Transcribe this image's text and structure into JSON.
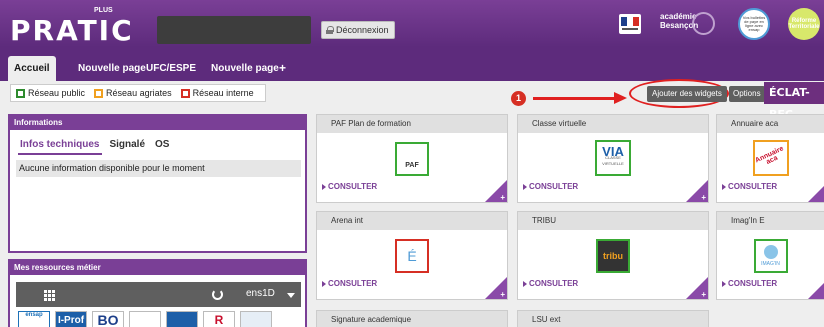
{
  "header": {
    "logo_main": "PRATIC",
    "logo_plus": "PLUS",
    "logout_label": "Déconnexion",
    "academie": [
      "académie",
      "Besançon"
    ],
    "badge_bulletins": "Vos bulletins de paye en ligne avec ensap",
    "badge_reforme": [
      "Réforme",
      "Territoriale"
    ]
  },
  "tabs": [
    {
      "label": "Accueil"
    },
    {
      "label": "Nouvelle page"
    },
    {
      "label": "UFC/ESPE"
    },
    {
      "label": "Nouvelle page"
    },
    {
      "label": "+"
    }
  ],
  "filters": [
    {
      "label": "Réseau public",
      "color": "#2e8b2e"
    },
    {
      "label": "Réseau agriates",
      "color": "#f0a020"
    },
    {
      "label": "Réseau interne",
      "color": "#d62f24"
    }
  ],
  "actions": {
    "add_widgets": "Ajouter des widgets",
    "options": "Options",
    "eclat": "ÉCLAT-BFC"
  },
  "annotation": {
    "number": "1"
  },
  "informations": {
    "title": "Informations",
    "tabs": [
      "Infos techniques",
      "Signalé",
      "OS"
    ],
    "message": "Aucune information disponible pour le moment"
  },
  "ressources": {
    "title": "Mes ressources métier",
    "selected": "ens1D",
    "icons": [
      "ensap",
      "I-Prof",
      "BO",
      "",
      "",
      "R",
      ""
    ]
  },
  "widgets": [
    {
      "title": "PAF Plan de formation",
      "logo": "PAF",
      "link": "CONSULTER",
      "color": "#3aaa35"
    },
    {
      "title": "Classe virtuelle",
      "logo": "VIA",
      "sub": "CLASSE VIRTUELLE",
      "link": "CONSULTER",
      "color": "#3aaa35"
    },
    {
      "title": "Annuaire aca",
      "logo": "Annuaire aca",
      "link": "CONSULTER",
      "color": "#f0a020"
    },
    {
      "title": "Arena int",
      "logo": "É",
      "link": "CONSULTER",
      "color": "#d62f24"
    },
    {
      "title": "TRIBU",
      "logo": "tribu",
      "link": "CONSULTER",
      "color": "#3aaa35"
    },
    {
      "title": "Imag'In E",
      "logo": "IMAG'IN",
      "link": "CONSULTER",
      "color": "#3aaa35"
    },
    {
      "title": "Signature academique"
    },
    {
      "title": "LSU ext"
    }
  ]
}
